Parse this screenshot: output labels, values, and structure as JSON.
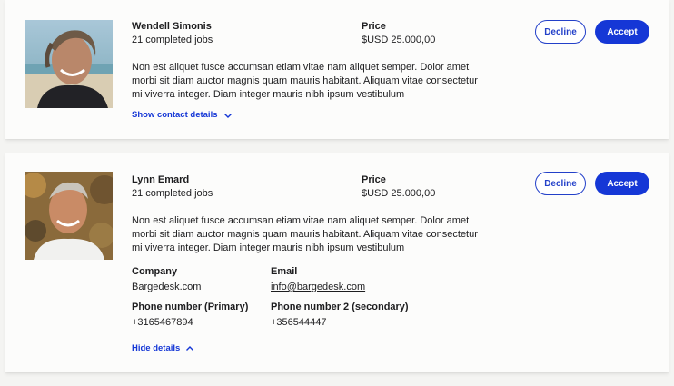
{
  "offers": [
    {
      "photo_icon": "person-photo",
      "name": "Wendell Simonis",
      "jobs": "21 completed jobs",
      "price_label": "Price",
      "price_value": "$USD 25.000,00",
      "decline_label": "Decline",
      "accept_label": "Accept",
      "description": "Non est aliquet fusce accumsan etiam vitae nam aliquet semper. Dolor amet morbi sit diam auctor magnis quam mauris habitant. Aliquam vitae consectetur mi viverra integer. Diam integer mauris nibh ipsum vestibulum",
      "toggle_label": "Show contact details",
      "toggle_icon": "chevron-down-icon",
      "expanded": false
    },
    {
      "photo_icon": "person-photo",
      "name": "Lynn Emard",
      "jobs": "21 completed jobs",
      "price_label": "Price",
      "price_value": "$USD 25.000,00",
      "decline_label": "Decline",
      "accept_label": "Accept",
      "description": "Non est aliquet fusce accumsan etiam vitae nam aliquet semper. Dolor amet morbi sit diam auctor magnis quam mauris habitant. Aliquam vitae consectetur mi viverra integer. Diam integer mauris nibh ipsum vestibulum",
      "details": {
        "company_label": "Company",
        "company_value": "Bargedesk.com",
        "email_label": "Email",
        "email_value": "info@bargedesk.com",
        "phone1_label": "Phone number (Primary)",
        "phone1_value": "+3165467894",
        "phone2_label": "Phone number 2 (secondary)",
        "phone2_value": "+356544447"
      },
      "toggle_label": "Hide details",
      "toggle_icon": "chevron-up-icon",
      "expanded": true
    }
  ],
  "colors": {
    "accent": "#1537d6",
    "page_bg": "#f4f4f2",
    "card_bg": "#fcfcfb"
  }
}
